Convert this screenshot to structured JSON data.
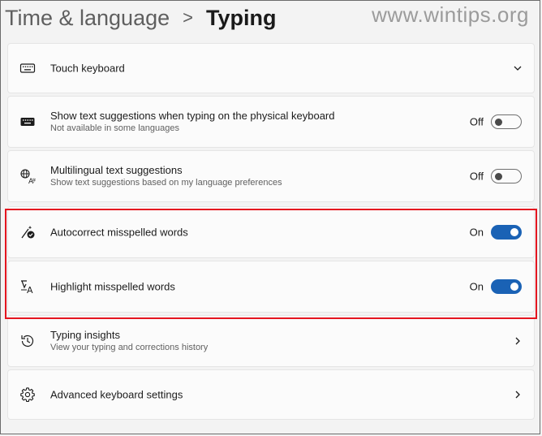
{
  "header": {
    "parent": "Time & language",
    "separator": ">",
    "current": "Typing",
    "watermark": "www.wintips.org"
  },
  "rows": [
    {
      "icon": "keyboard-icon",
      "title": "Touch keyboard",
      "control": "chevron-down"
    },
    {
      "icon": "keyboard-icon",
      "title": "Show text suggestions when typing on the physical keyboard",
      "subtitle": "Not available in some languages",
      "state": "Off",
      "toggle": "off"
    },
    {
      "icon": "language-icon",
      "title": "Multilingual text suggestions",
      "subtitle": "Show text suggestions based on my language preferences",
      "state": "Off",
      "toggle": "off"
    },
    {
      "icon": "autocorrect-icon",
      "title": "Autocorrect misspelled words",
      "state": "On",
      "toggle": "on"
    },
    {
      "icon": "spellcheck-highlight-icon",
      "title": "Highlight misspelled words",
      "state": "On",
      "toggle": "on"
    },
    {
      "icon": "history-icon",
      "title": "Typing insights",
      "subtitle": "View your typing and corrections history",
      "control": "chevron-right"
    },
    {
      "icon": "gear-icon",
      "title": "Advanced keyboard settings",
      "control": "chevron-right"
    }
  ],
  "colors": {
    "accent": "#1a62b5",
    "highlight_border": "#e4151f",
    "background": "#f3f3f3",
    "card": "#fbfbfb"
  }
}
